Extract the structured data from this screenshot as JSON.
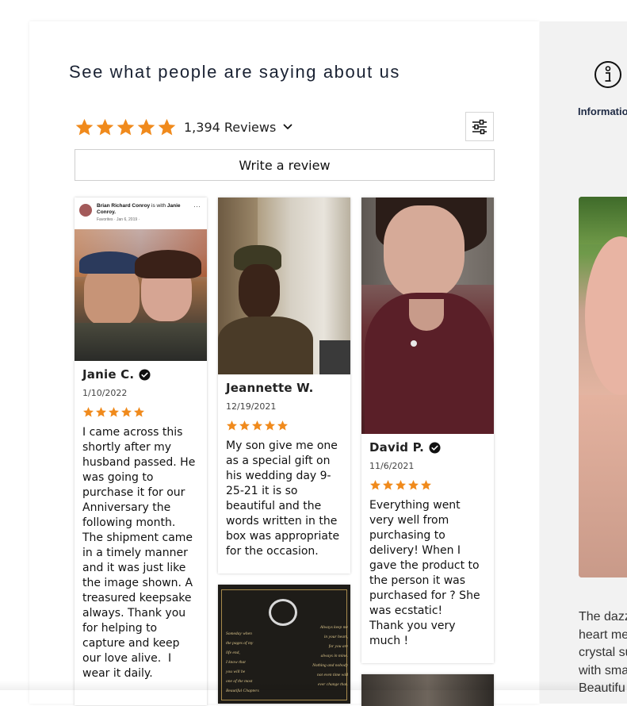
{
  "section": {
    "heading": "See what people are saying about us"
  },
  "summary": {
    "rating": 5,
    "review_count": "1,394 Reviews",
    "write_review_label": "Write a review",
    "star_color": "#f08a1c"
  },
  "reviews": [
    {
      "name": "Janie C.",
      "verified": true,
      "date": "1/10/2022",
      "rating": 5,
      "photo_caption_author": "Brian Richard Conroy",
      "photo_caption_with": "is with",
      "photo_caption_tagged": "Janie Conroy.",
      "photo_caption_meta": "Favorites · Jan 6, 2019 ·",
      "text": "I came across this shortly after my husband passed. He was going to purchase it for our Anniversary the following month. The shipment came in a timely manner and it was just like the image shown. A treasured keepsake always. Thank you for helping to capture and keep our love alive.  I wear it daily."
    },
    {
      "name": "Jeannette W.",
      "verified": false,
      "date": "12/19/2021",
      "rating": 5,
      "text": "My son give me one as a special gift on his wedding day 9-25-21 it is so beautiful and the words written in the box was appropriate for the occasion."
    },
    {
      "name": "David P.",
      "verified": true,
      "date": "11/6/2021",
      "rating": 5,
      "text": "Everything went very well from purchasing to delivery! When I gave the product to the person it was purchased for ? She was ecstatic!\nThank you very much !"
    }
  ],
  "gift_card": {
    "left_text": "Someday when\nthe pages of my\nlife end,\nI know that\nyou will be\none of the most\nBeautiful Chapters",
    "right_text": "Always keep me\nin your heart,\nfor you are\nalways in mine.\nNothing and nobody\nnot even time will\never change that."
  },
  "info": {
    "icon": "info-icon",
    "label": "Informatio"
  },
  "product": {
    "description_lines": [
      "The dazz",
      "heart me",
      "crystal su",
      "with sma",
      "Beautifu"
    ]
  }
}
